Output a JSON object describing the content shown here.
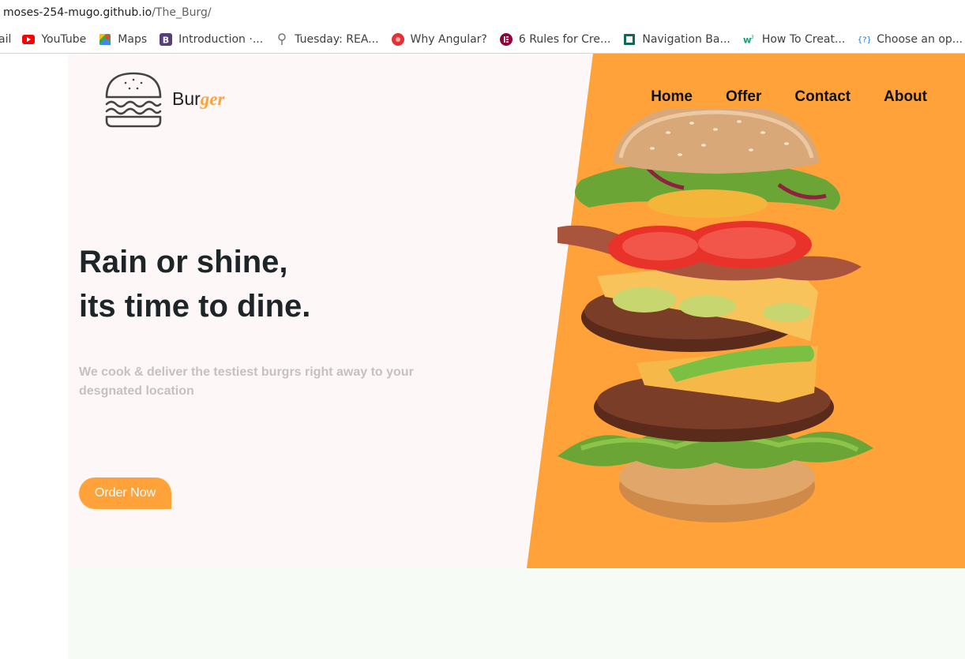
{
  "browser": {
    "url_host": "moses-254-mugo.github.io",
    "url_path": "/The_Burg/",
    "bookmarks": [
      {
        "label": "ail",
        "icon": "mail-icon"
      },
      {
        "label": "YouTube",
        "icon": "youtube-icon"
      },
      {
        "label": "Maps",
        "icon": "maps-icon"
      },
      {
        "label": "Introduction ·...",
        "icon": "bootstrap-icon"
      },
      {
        "label": "Tuesday: REA...",
        "icon": "tree-icon"
      },
      {
        "label": "Why Angular?",
        "icon": "angular-icon"
      },
      {
        "label": "6 Rules for Cre...",
        "icon": "elementor-icon"
      },
      {
        "label": "Navigation Ba...",
        "icon": "bookmark-icon"
      },
      {
        "label": "How To Creat...",
        "icon": "w3-icon"
      },
      {
        "label": "Choose an op...",
        "icon": "question-icon"
      }
    ]
  },
  "site": {
    "logo_main": "Bur",
    "logo_accent": "ger",
    "nav": [
      "Home",
      "Offer",
      "Contact",
      "About"
    ],
    "headline_line1": "Rain or shine,",
    "headline_line2": "its time to dine.",
    "subtext": "We cook & deliver the testiest burgrs right away to your desgnated location",
    "cta_label": "Order Now"
  },
  "colors": {
    "accent": "#ffa23a",
    "hero_bg": "#fdf8f7",
    "headline": "#1e2529",
    "subtext": "#c5c1c0",
    "lower_section_bg": "#f6fbf6"
  }
}
